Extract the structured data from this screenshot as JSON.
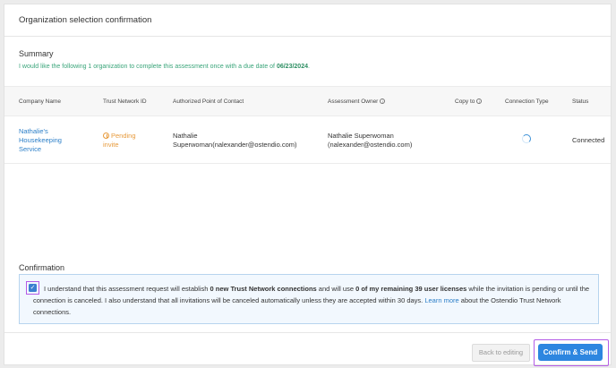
{
  "header": {
    "title": "Organization selection confirmation"
  },
  "summary": {
    "title": "Summary",
    "text_prefix": "I would like the following 1 organization to complete this assessment once with a due date of ",
    "due_date": "06/23/2024",
    "text_suffix": "."
  },
  "table": {
    "columns": [
      "Company Name",
      "Trust Network ID",
      "Authorized Point of Contact",
      "Assessment Owner",
      "Copy to",
      "Connection Type",
      "Status"
    ],
    "rows": [
      {
        "company_line1": "Nathalie's",
        "company_line2": "Housekeeping",
        "company_line3": "Service",
        "trust_line1": "Pending",
        "trust_line2": "invite",
        "contact_line1": "Nathalie",
        "contact_line2": "Superwoman(nalexander@ostendio.com)",
        "owner_line1": "Nathalie Superwoman",
        "owner_line2": "(nalexander@ostendio.com)",
        "status": "Connected"
      }
    ]
  },
  "confirmation": {
    "title": "Confirmation",
    "t1": "I understand that this assessment request will establish ",
    "b1": "0 new Trust Network connections",
    "t2": " and will use ",
    "b2": "0 of my remaining 39 user licenses",
    "t3": " while the invitation is pending or until the connection is canceled. I also understand that all invitations will be canceled automatically unless they are accepted within 30 days. ",
    "link": "Learn more",
    "t4": " about the Ostendio Trust Network connections.",
    "checkbox_mark": "✓"
  },
  "footer": {
    "back_label": "Back to editing",
    "send_label": "Confirm & Send"
  },
  "icons": {
    "info": "i"
  },
  "colors": {
    "accent": "#2d86e0",
    "success": "#3aa57a",
    "pending": "#e79a3b",
    "highlight": "#b45be6"
  }
}
